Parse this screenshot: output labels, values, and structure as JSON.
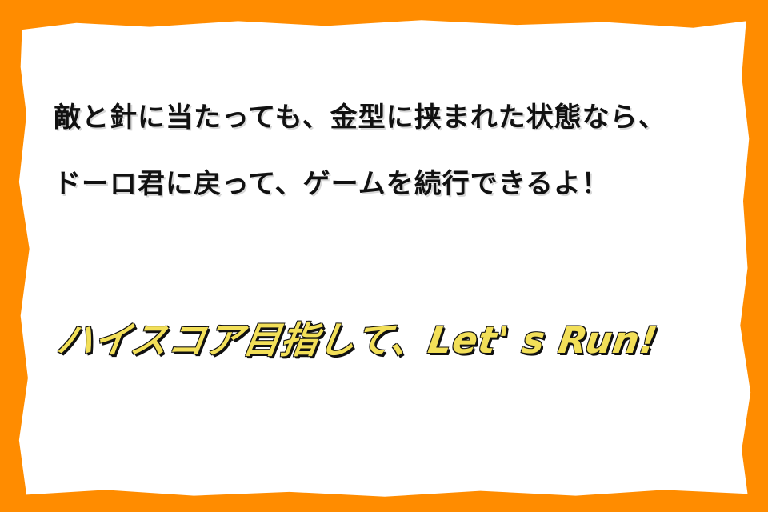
{
  "message": {
    "line1": "敵と針に当たっても、金型に挟まれた状態なら、",
    "line2": "ドーロ君に戻って、ゲームを続行できるよ！",
    "highlight": "ハイスコア目指して、Let' s Run!"
  },
  "colors": {
    "frame": "#ff8c00",
    "board": "#ffffff",
    "text": "#111111",
    "highlight": "#f2df58"
  }
}
